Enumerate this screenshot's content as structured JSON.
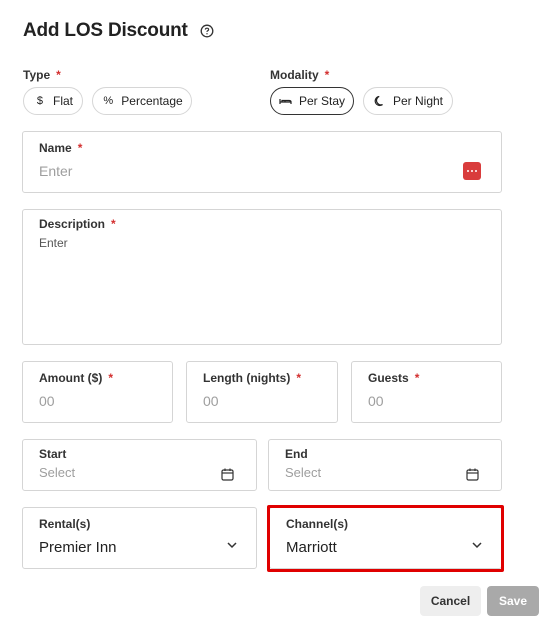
{
  "dialog": {
    "title": "Add LOS Discount"
  },
  "type": {
    "label": "Type",
    "required": "*",
    "options": [
      {
        "label": "Flat",
        "icon": "dollar-icon",
        "selected": false
      },
      {
        "label": "Percentage",
        "icon": "percent-icon",
        "selected": false
      }
    ]
  },
  "modality": {
    "label": "Modality",
    "required": "*",
    "options": [
      {
        "label": "Per Stay",
        "icon": "bed-icon",
        "selected": true
      },
      {
        "label": "Per Night",
        "icon": "moon-icon",
        "selected": false
      }
    ]
  },
  "name": {
    "label": "Name",
    "required": "*",
    "placeholder": "Enter"
  },
  "description": {
    "label": "Description",
    "required": "*",
    "placeholder": "Enter"
  },
  "amount": {
    "label": "Amount ($)",
    "required": "*",
    "placeholder": "00"
  },
  "length": {
    "label": "Length (nights)",
    "required": "*",
    "placeholder": "00"
  },
  "guests": {
    "label": "Guests",
    "required": "*",
    "placeholder": "00"
  },
  "start": {
    "label": "Start",
    "placeholder": "Select"
  },
  "end": {
    "label": "End",
    "placeholder": "Select"
  },
  "rentals": {
    "label": "Rental(s)",
    "value": "Premier Inn"
  },
  "channels": {
    "label": "Channel(s)",
    "value": "Marriott"
  },
  "actions": {
    "cancel_label": "Cancel",
    "save_label": "Save"
  },
  "colors": {
    "required": "#d32f2f",
    "highlight": "#e00000",
    "save_disabled": "#a9a9a9",
    "password_icon": "#d93c3c"
  }
}
